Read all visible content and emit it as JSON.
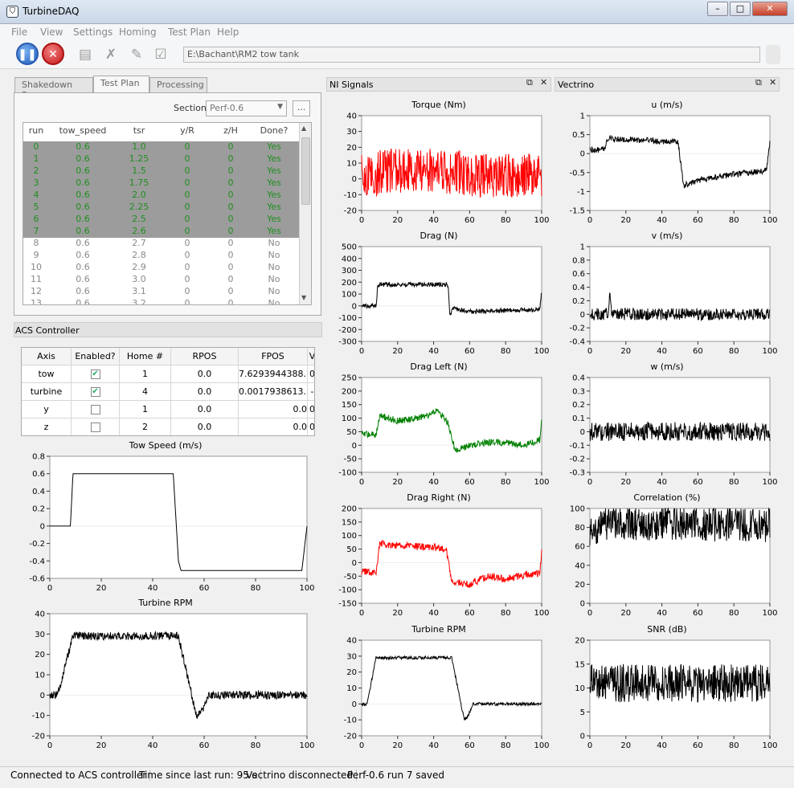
{
  "window": {
    "title": "TurbineDAQ",
    "app_icon": "shield-icon"
  },
  "menu": [
    "File",
    "View",
    "Settings",
    "Homing",
    "Test Plan",
    "Help"
  ],
  "toolbar": {
    "path_text": "E:\\Bachant\\RM2 tow tank"
  },
  "tabs": [
    "Shakedown Run",
    "Test Plan",
    "Processing"
  ],
  "test_plan": {
    "section_label": "Section",
    "section_value": "Perf-0.6",
    "more_button": "...",
    "columns": [
      "run",
      "tow_speed",
      "tsr",
      "y/R",
      "z/H",
      "Done?"
    ],
    "rows": [
      [
        "0",
        "0.6",
        "1.0",
        "0",
        "0",
        "Yes"
      ],
      [
        "1",
        "0.6",
        "1.25",
        "0",
        "0",
        "Yes"
      ],
      [
        "2",
        "0.6",
        "1.5",
        "0",
        "0",
        "Yes"
      ],
      [
        "3",
        "0.6",
        "1.75",
        "0",
        "0",
        "Yes"
      ],
      [
        "4",
        "0.6",
        "2.0",
        "0",
        "0",
        "Yes"
      ],
      [
        "5",
        "0.6",
        "2.25",
        "0",
        "0",
        "Yes"
      ],
      [
        "6",
        "0.6",
        "2.5",
        "0",
        "0",
        "Yes"
      ],
      [
        "7",
        "0.6",
        "2.6",
        "0",
        "0",
        "Yes"
      ],
      [
        "8",
        "0.6",
        "2.7",
        "0",
        "0",
        "No"
      ],
      [
        "9",
        "0.6",
        "2.8",
        "0",
        "0",
        "No"
      ],
      [
        "10",
        "0.6",
        "2.9",
        "0",
        "0",
        "No"
      ],
      [
        "11",
        "0.6",
        "3.0",
        "0",
        "0",
        "No"
      ],
      [
        "12",
        "0.6",
        "3.1",
        "0",
        "0",
        "No"
      ],
      [
        "13",
        "0.6",
        "3.2",
        "0",
        "0",
        "No"
      ]
    ]
  },
  "acs": {
    "header": "ACS Controller",
    "columns": [
      "Axis",
      "Enabled?",
      "Home #",
      "RPOS",
      "FPOS",
      "V"
    ],
    "rows": [
      {
        "axis": "tow",
        "enabled": true,
        "home": "1",
        "rpos": "0.0",
        "fpos": "7.6293944388...",
        "v": "0"
      },
      {
        "axis": "turbine",
        "enabled": true,
        "home": "4",
        "rpos": "0.0",
        "fpos": "0.0017938613...",
        "v": "-"
      },
      {
        "axis": "y",
        "enabled": false,
        "home": "1",
        "rpos": "0.0",
        "fpos": "0.0",
        "v": "0"
      },
      {
        "axis": "z",
        "enabled": false,
        "home": "2",
        "rpos": "0.0",
        "fpos": "0.0",
        "v": "0"
      }
    ]
  },
  "docks": {
    "ni_title": "NI Signals",
    "vec_title": "Vectrino",
    "float_icon": "float-icon",
    "close_icon": "close-icon"
  },
  "status": [
    "Connected to ACS controller",
    "Time since last run: 95 s",
    "Vectrino disconnected",
    "Perf-0.6 run 7 saved"
  ],
  "chart_data": [
    {
      "id": "tow_speed",
      "type": "line",
      "title": "Tow Speed (m/s)",
      "xlim": [
        0,
        100
      ],
      "ylim": [
        -0.6,
        0.8
      ],
      "xticks": [
        0,
        20,
        40,
        60,
        80,
        100
      ],
      "yticks": [
        -0.6,
        -0.4,
        -0.2,
        0,
        0.2,
        0.4,
        0.6,
        0.8
      ],
      "color": "#000000",
      "noise": 0,
      "x": [
        0,
        8,
        9,
        48,
        50,
        51,
        98,
        100
      ],
      "y": [
        0,
        0,
        0.6,
        0.6,
        -0.4,
        -0.51,
        -0.51,
        0
      ]
    },
    {
      "id": "acs_rpm",
      "type": "line",
      "title": "Turbine RPM",
      "xlim": [
        0,
        100
      ],
      "ylim": [
        -20,
        40
      ],
      "xticks": [
        0,
        20,
        40,
        60,
        80,
        100
      ],
      "yticks": [
        -20,
        -10,
        0,
        10,
        20,
        30,
        40
      ],
      "color": "#000000",
      "noise": 2,
      "x": [
        0,
        3,
        9,
        50,
        57,
        59,
        62,
        100
      ],
      "y": [
        0,
        0,
        29,
        29,
        -10,
        -8,
        0,
        0
      ]
    },
    {
      "id": "torque",
      "type": "line",
      "title": "Torque (Nm)",
      "xlim": [
        0,
        100
      ],
      "ylim": [
        -20,
        40
      ],
      "xticks": [
        0,
        20,
        40,
        60,
        80,
        100
      ],
      "yticks": [
        -20,
        -10,
        0,
        10,
        20,
        30,
        40
      ],
      "color": "#ff0000",
      "noise": 14,
      "x": [
        0,
        8,
        10,
        47,
        50,
        55,
        58,
        100
      ],
      "y": [
        1,
        1,
        5,
        5,
        3,
        5,
        2,
        2
      ]
    },
    {
      "id": "drag",
      "type": "line",
      "title": "Drag (N)",
      "xlim": [
        0,
        100
      ],
      "ylim": [
        -300,
        500
      ],
      "xticks": [
        0,
        20,
        40,
        60,
        80,
        100
      ],
      "yticks": [
        -300,
        -200,
        -100,
        0,
        100,
        200,
        300,
        400,
        500
      ],
      "color": "#000000",
      "noise": 20,
      "x": [
        0,
        8,
        9,
        48,
        49,
        51,
        60,
        99,
        100
      ],
      "y": [
        0,
        0,
        180,
        180,
        -80,
        -20,
        -50,
        -30,
        120
      ]
    },
    {
      "id": "drag_left",
      "type": "line",
      "title": "Drag Left (N)",
      "xlim": [
        0,
        100
      ],
      "ylim": [
        -100,
        250
      ],
      "xticks": [
        0,
        20,
        40,
        60,
        80,
        100
      ],
      "yticks": [
        -100,
        -50,
        0,
        50,
        100,
        150,
        200,
        250
      ],
      "color": "#008000",
      "noise": 12,
      "x": [
        0,
        8,
        10,
        20,
        30,
        38,
        42,
        48,
        52,
        60,
        70,
        80,
        90,
        99,
        100
      ],
      "y": [
        40,
        40,
        110,
        90,
        100,
        110,
        130,
        80,
        -20,
        0,
        10,
        10,
        0,
        20,
        100
      ]
    },
    {
      "id": "drag_right",
      "type": "line",
      "title": "Drag Right (N)",
      "xlim": [
        0,
        100
      ],
      "ylim": [
        -150,
        200
      ],
      "xticks": [
        0,
        20,
        40,
        60,
        80,
        100
      ],
      "yticks": [
        -150,
        -100,
        -50,
        0,
        50,
        100,
        150,
        200
      ],
      "color": "#ff0000",
      "noise": 14,
      "x": [
        0,
        8,
        10,
        30,
        40,
        47,
        50,
        60,
        70,
        80,
        90,
        99,
        100
      ],
      "y": [
        -35,
        -35,
        70,
        60,
        55,
        50,
        -70,
        -80,
        -50,
        -60,
        -45,
        -40,
        50
      ]
    },
    {
      "id": "ni_rpm",
      "type": "line",
      "title": "Turbine RPM",
      "xlim": [
        0,
        100
      ],
      "ylim": [
        -20,
        40
      ],
      "xticks": [
        0,
        20,
        40,
        60,
        80,
        100
      ],
      "yticks": [
        -20,
        -10,
        0,
        10,
        20,
        30,
        40
      ],
      "color": "#000000",
      "noise": 1,
      "x": [
        0,
        3,
        8,
        50,
        57,
        59,
        62,
        100
      ],
      "y": [
        0,
        0,
        29,
        29,
        -10,
        -8,
        0,
        0
      ]
    },
    {
      "id": "u",
      "type": "line",
      "title": "u (m/s)",
      "xlim": [
        0,
        100
      ],
      "ylim": [
        -1.5,
        1
      ],
      "xticks": [
        0,
        20,
        40,
        60,
        80,
        100
      ],
      "yticks": [
        -1.5,
        -1,
        -0.5,
        0,
        0.5,
        1
      ],
      "color": "#000000",
      "noise": 0.08,
      "x": [
        0,
        8,
        10,
        49,
        52,
        60,
        80,
        98,
        100
      ],
      "y": [
        0.1,
        0.1,
        0.4,
        0.3,
        -0.85,
        -0.7,
        -0.55,
        -0.45,
        0.3
      ]
    },
    {
      "id": "v",
      "type": "line",
      "title": "v (m/s)",
      "xlim": [
        0,
        100
      ],
      "ylim": [
        -0.4,
        1
      ],
      "xticks": [
        0,
        20,
        40,
        60,
        80,
        100
      ],
      "yticks": [
        -0.4,
        -0.2,
        0,
        0.2,
        0.4,
        0.6,
        0.8,
        1
      ],
      "color": "#000000",
      "noise": 0.09,
      "x": [
        0,
        10,
        11,
        12,
        100
      ],
      "y": [
        0,
        0,
        0.3,
        0,
        0
      ]
    },
    {
      "id": "w",
      "type": "line",
      "title": "w (m/s)",
      "xlim": [
        0,
        100
      ],
      "ylim": [
        -0.3,
        0.4
      ],
      "xticks": [
        0,
        20,
        40,
        60,
        80,
        100
      ],
      "yticks": [
        -0.3,
        -0.2,
        -0.1,
        0,
        0.1,
        0.2,
        0.3,
        0.4
      ],
      "color": "#000000",
      "noise": 0.07,
      "x": [
        0,
        100
      ],
      "y": [
        0,
        0
      ]
    },
    {
      "id": "correlation",
      "type": "line",
      "title": "Correlation (%)",
      "xlim": [
        0,
        100
      ],
      "ylim": [
        0,
        100
      ],
      "xticks": [
        0,
        20,
        40,
        60,
        80,
        100
      ],
      "yticks": [
        0,
        20,
        40,
        60,
        80,
        100
      ],
      "color": "#000000",
      "noise": 18,
      "x": [
        0,
        10,
        100
      ],
      "y": [
        78,
        85,
        82
      ]
    },
    {
      "id": "snr",
      "type": "line",
      "title": "SNR (dB)",
      "xlim": [
        0,
        100
      ],
      "ylim": [
        0,
        20
      ],
      "xticks": [
        0,
        20,
        40,
        60,
        80,
        100
      ],
      "yticks": [
        0,
        5,
        10,
        15,
        20
      ],
      "color": "#000000",
      "noise": 4,
      "x": [
        0,
        100
      ],
      "y": [
        11,
        11
      ]
    }
  ]
}
